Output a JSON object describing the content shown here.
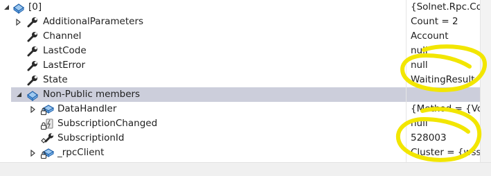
{
  "rows": [
    {
      "name": "[0]",
      "value": "{Solnet.Rpc.Cor",
      "icon": "object-blue-icon",
      "expander": "collapse"
    },
    {
      "name": "AdditionalParameters",
      "value": "Count = 2",
      "icon": "wrench-icon",
      "expander": "expand"
    },
    {
      "name": "Channel",
      "value": "Account",
      "icon": "wrench-icon",
      "expander": ""
    },
    {
      "name": "LastCode",
      "value": "null",
      "icon": "wrench-icon",
      "expander": ""
    },
    {
      "name": "LastError",
      "value": "null",
      "icon": "wrench-icon",
      "expander": ""
    },
    {
      "name": "State",
      "value": "WaitingResult",
      "icon": "wrench-icon",
      "expander": ""
    },
    {
      "name": "Non-Public members",
      "value": "",
      "icon": "members-icon",
      "expander": "collapse"
    },
    {
      "name": "DataHandler",
      "value": "{Method = {Voi",
      "icon": "private-field-icon",
      "expander": "expand"
    },
    {
      "name": "SubscriptionChanged",
      "value": "null",
      "icon": "private-event-icon",
      "expander": ""
    },
    {
      "name": "SubscriptionId",
      "value": "528003",
      "icon": "private-wrench-icon",
      "expander": ""
    },
    {
      "name": "_rpcClient",
      "value": "Cluster = {wss:/",
      "icon": "private-field-icon",
      "expander": "expand"
    }
  ],
  "colors": {
    "selection": "#cccedb",
    "annotation_marker": "#f2e600"
  }
}
